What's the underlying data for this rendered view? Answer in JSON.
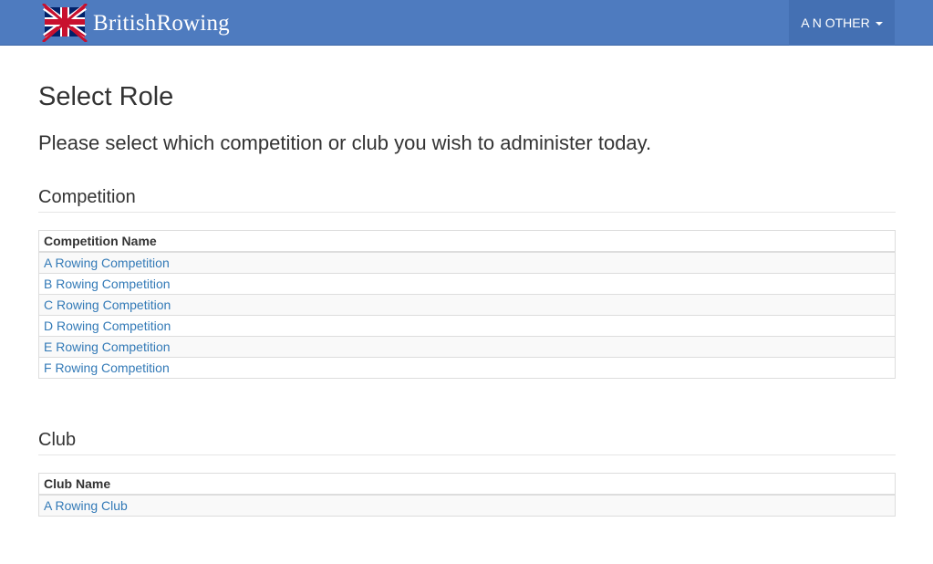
{
  "header": {
    "brand": {
      "first": "British",
      "second": "Rowing"
    },
    "user_menu": "A N OTHER"
  },
  "page": {
    "title": "Select Role",
    "lead": "Please select which competition or club you wish to administer today."
  },
  "competition": {
    "heading": "Competition",
    "column": "Competition Name",
    "rows": [
      "A Rowing Competition",
      "B Rowing Competition",
      "C Rowing Competition",
      "D Rowing Competition",
      "E Rowing Competition",
      "F Rowing Competition"
    ]
  },
  "club": {
    "heading": "Club",
    "column": "Club Name",
    "rows": [
      "A Rowing Club"
    ]
  },
  "colors": {
    "navbar": "#4e7bbf",
    "link": "#337ab7",
    "flag_red": "#c8102e",
    "flag_blue": "#012169"
  }
}
